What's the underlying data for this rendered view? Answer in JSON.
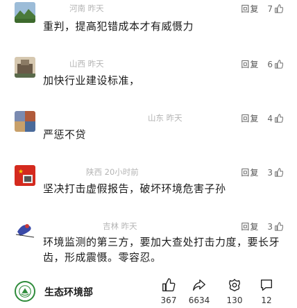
{
  "comments": [
    {
      "location": "河南 昨天",
      "text": "重判，提高犯错成本才有威慑力",
      "reply": "回复",
      "likes": "7"
    },
    {
      "location": "山西 昨天",
      "text": "加快行业建设标准，",
      "reply": "回复",
      "likes": "6"
    },
    {
      "location": "山东 昨天",
      "text": "严惩不贷",
      "reply": "回复",
      "likes": "4"
    },
    {
      "location": "陕西 20小时前",
      "text": "坚决打击虚假报告，破坏环境危害子孙",
      "reply": "回复",
      "likes": "3"
    },
    {
      "location": "吉林 昨天",
      "text": "环境监测的第三方，要加大查处打击力度，要长牙齿，形成震慑。零容忍。",
      "reply": "回复",
      "likes": "3"
    }
  ],
  "bottom_bar": {
    "org_name": "生态环境部",
    "like_count": "367",
    "share_count": "6634",
    "favorite_count": "130",
    "comment_count": "12"
  },
  "colors": {
    "logo_green": "#2e8b3a",
    "meta_gray": "#b4b4b4"
  },
  "icons": [
    "thumbs-up-icon",
    "share-icon",
    "favorite-icon",
    "comment-icon",
    "ministry-emblem-icon"
  ]
}
